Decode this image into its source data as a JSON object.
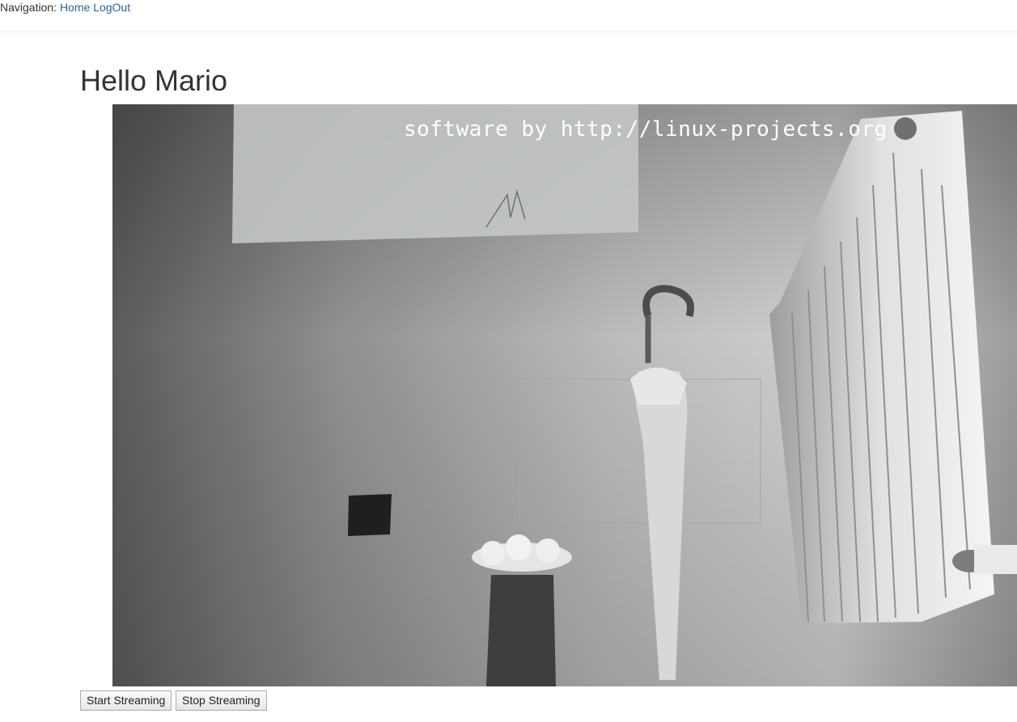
{
  "nav": {
    "label": "Navigation:",
    "links": [
      "Home",
      "LogOut"
    ]
  },
  "greeting": "Hello Mario",
  "stream": {
    "overlay_text": "software by http://linux-projects.org"
  },
  "buttons": {
    "start": "Start Streaming",
    "stop": "Stop Streaming"
  },
  "colors": {
    "link": "#2a6496",
    "heading": "#333333"
  }
}
